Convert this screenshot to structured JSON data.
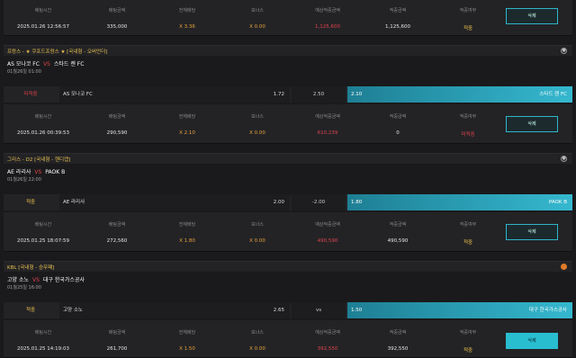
{
  "labels": {
    "bet_time": "배팅시간",
    "bet_amount": "배팅금액",
    "total_odds": "전체배당",
    "bonus": "보너스",
    "expected_amount": "예상적중금액",
    "hit_amount": "적중금액",
    "hit_status": "적중여부",
    "delete": "삭제"
  },
  "slips": [
    {
      "summary": {
        "time": "2025.01.26 12:56:57",
        "amount": "335,000",
        "odds": "X 3.36",
        "bonus": "X 0.00",
        "expected": "1,125,600",
        "hit": "1,125,600",
        "status": "적중"
      },
      "league": null,
      "match": null
    },
    {
      "league": {
        "name": "프랑스 - ★ 쿠프드프랑스 ★ [국내형 - 오버언더]",
        "icon": "soccer"
      },
      "match": {
        "home": "AS 모나코 FC",
        "vs": "VS",
        "away": "스타드 렌 FC",
        "time": "01월26일 01:00"
      },
      "bet": {
        "pick": "미적중",
        "pick_color": "red",
        "home": "AS 모나코 FC",
        "home_odds": "1.72",
        "draw": "2.50",
        "away_odds": "2.10",
        "away": "스타드 렌 FC"
      },
      "summary": {
        "time": "2025.01.26 00:39:53",
        "amount": "290,590",
        "odds": "X 2.10",
        "bonus": "X 0.00",
        "expected": "610,239",
        "hit": "0",
        "status": "미적중"
      }
    },
    {
      "league": {
        "name": "그리스 - D2 [국내형 - 핸디캡]",
        "icon": "soccer"
      },
      "match": {
        "home": "AE 라리사",
        "vs": "VS",
        "away": "PAOK B",
        "time": "01월26일 22:00"
      },
      "bet": {
        "pick": "적중",
        "pick_color": "yellow",
        "home": "AE 라리사",
        "home_odds": "2.00",
        "draw": "-2.00",
        "away_odds": "1.80",
        "away": "PAOK B"
      },
      "summary": {
        "time": "2025.01.25 18:07:59",
        "amount": "272,560",
        "odds": "X 1.80",
        "bonus": "X 0.00",
        "expected": "490,590",
        "hit": "490,590",
        "status": "적중"
      }
    },
    {
      "league": {
        "name": "KBL [국내형 - 승무패]",
        "icon": "basketball"
      },
      "match": {
        "home": "고양 소노",
        "vs": "VS",
        "away": "대구 한국가스공사",
        "time": "01월25일 16:00"
      },
      "bet": {
        "pick": "적중",
        "pick_color": "yellow",
        "home": "고양 소노",
        "home_odds": "2.65",
        "draw": "vs",
        "away_odds": "1.50",
        "away": "대구 한국가스공사"
      },
      "summary": {
        "time": "2025.01.25 14:19:03",
        "amount": "261,700",
        "odds": "X 1.50",
        "bonus": "X 0.00",
        "expected": "392,550",
        "hit": "392,550",
        "status": "적중"
      }
    }
  ]
}
